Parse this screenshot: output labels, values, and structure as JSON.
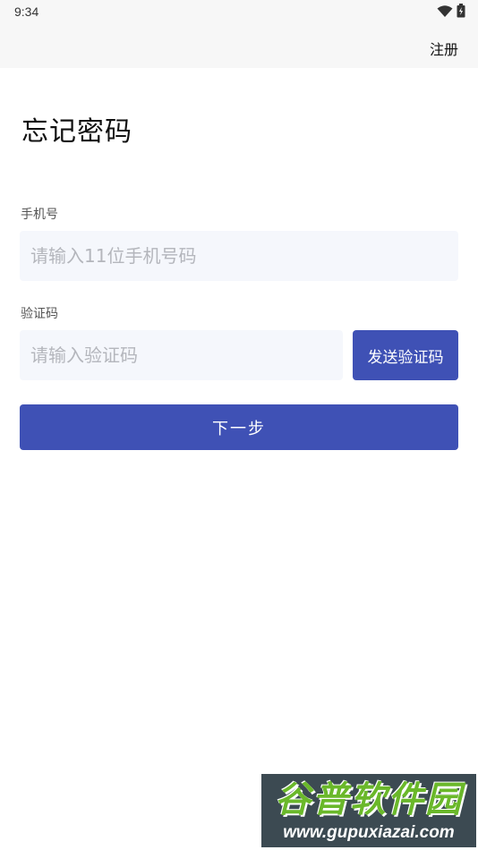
{
  "status_bar": {
    "time": "9:34",
    "icons": [
      "wifi-icon",
      "battery-icon"
    ]
  },
  "app_bar": {
    "register_label": "注册"
  },
  "page": {
    "title": "忘记密码"
  },
  "form": {
    "phone_label": "手机号",
    "phone_placeholder": "请输入11位手机号码",
    "phone_value": "",
    "code_label": "验证码",
    "code_placeholder": "请输入验证码",
    "code_value": "",
    "send_code_label": "发送验证码",
    "next_label": "下一步"
  },
  "watermark": {
    "title": "谷普软件园",
    "url": "www.gupuxiazai.com"
  },
  "colors": {
    "primary": "#3f51b5",
    "input_background": "#f5f7fc",
    "app_bar_background": "#f7f7f7",
    "placeholder": "#b4b6bc"
  }
}
